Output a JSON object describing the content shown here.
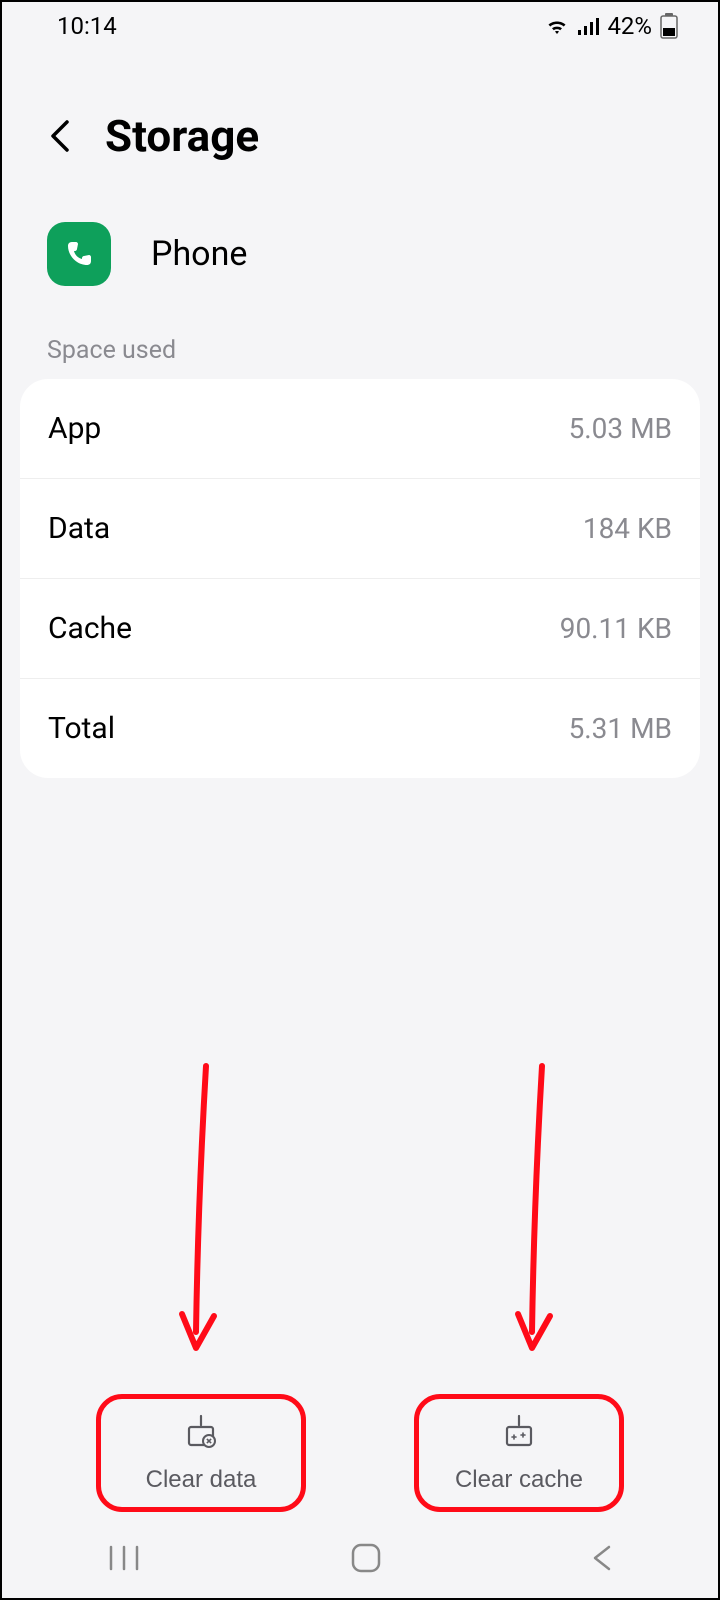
{
  "status": {
    "time": "10:14",
    "battery": "42%"
  },
  "header": {
    "title": "Storage"
  },
  "app": {
    "name": "Phone"
  },
  "section": {
    "space_used_label": "Space used"
  },
  "rows": {
    "app": {
      "label": "App",
      "value": "5.03 MB"
    },
    "data": {
      "label": "Data",
      "value": "184 KB"
    },
    "cache": {
      "label": "Cache",
      "value": "90.11 KB"
    },
    "total": {
      "label": "Total",
      "value": "5.31 MB"
    }
  },
  "actions": {
    "clear_data": "Clear data",
    "clear_cache": "Clear cache"
  }
}
